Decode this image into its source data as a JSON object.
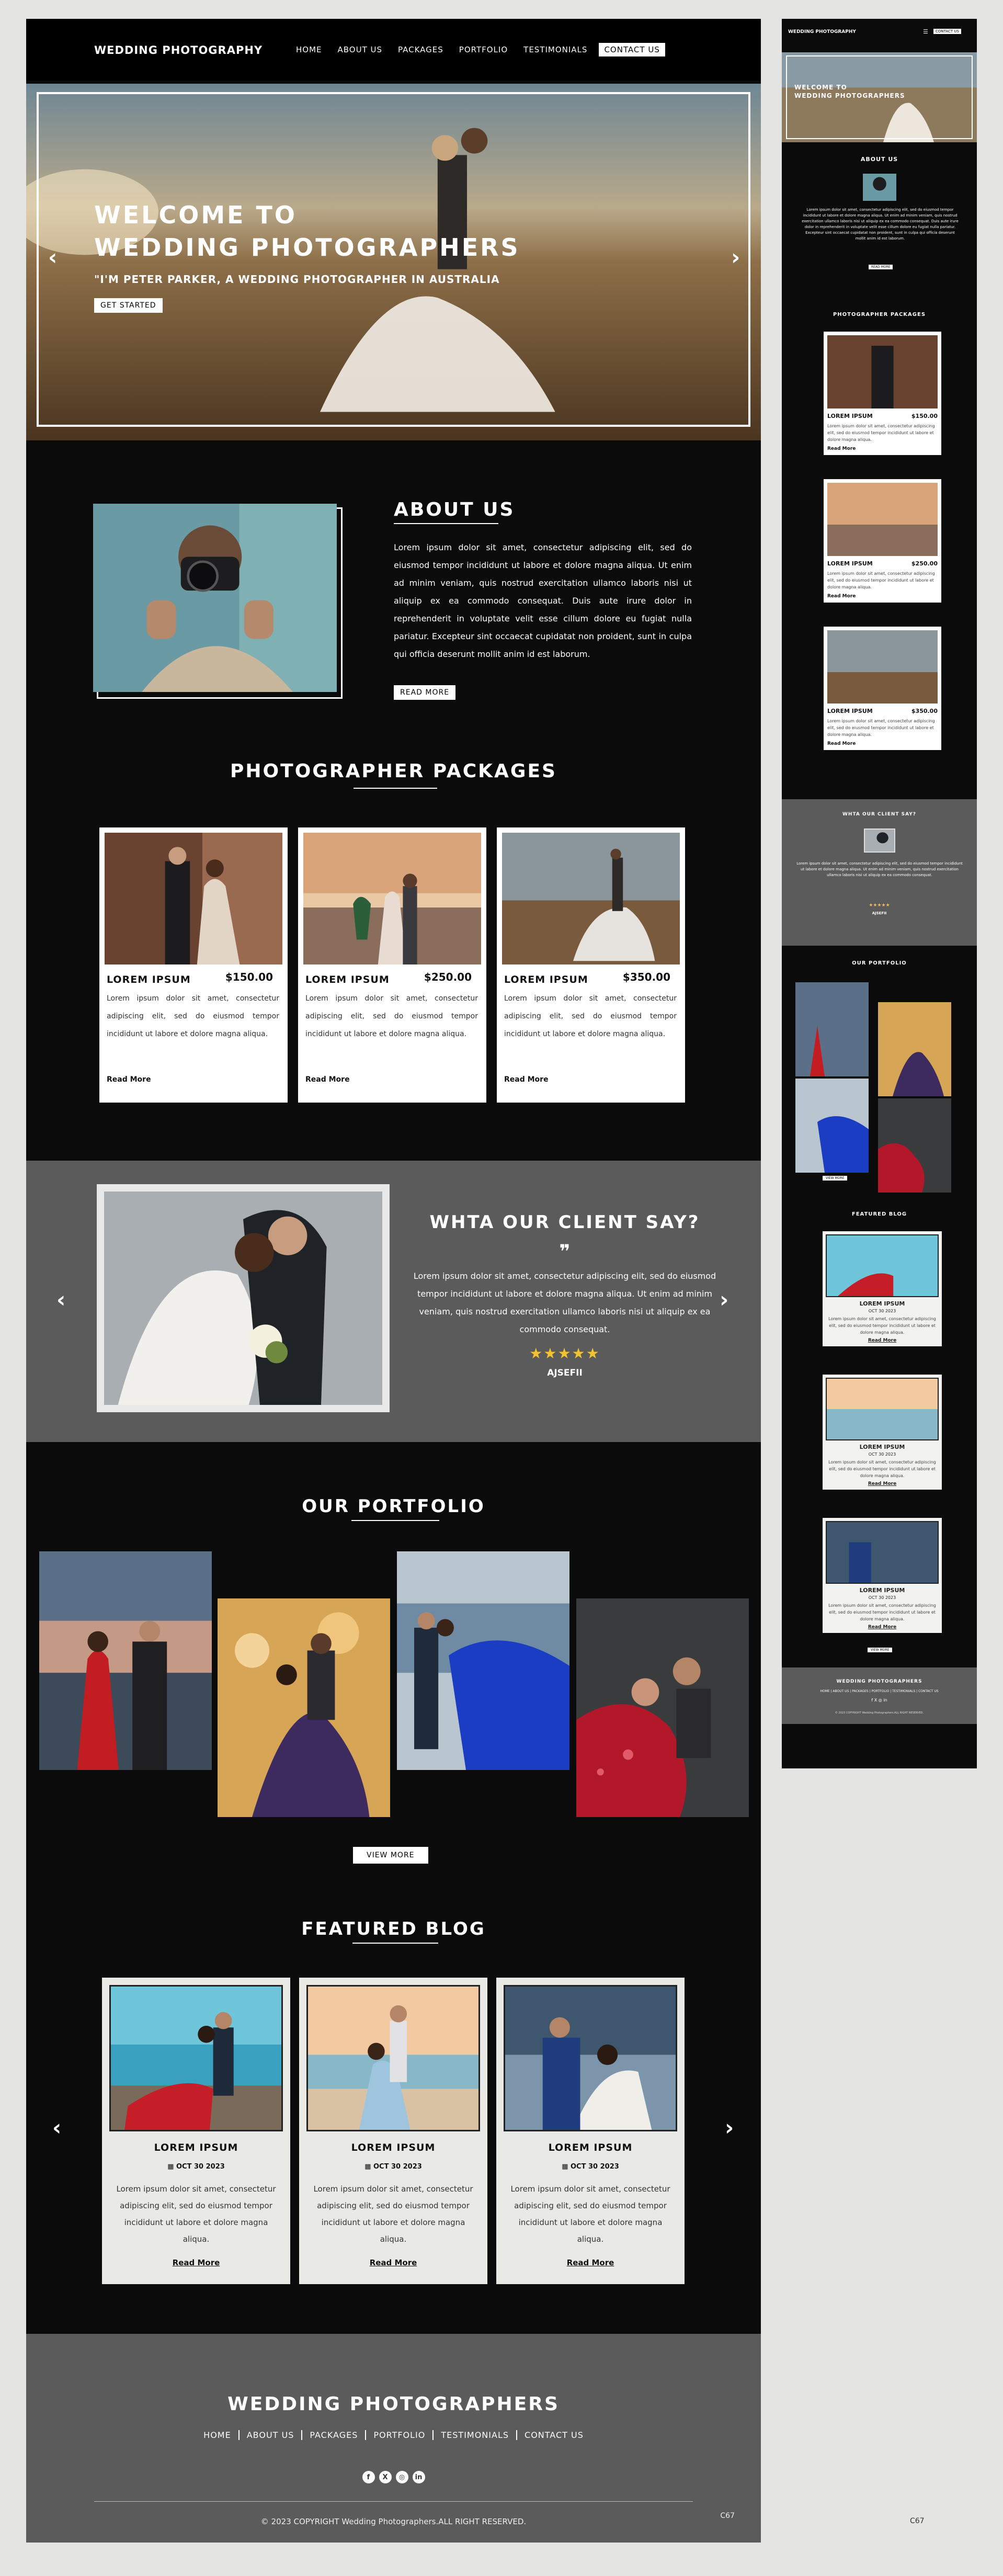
{
  "brand": "WEDDING PHOTOGRAPHY",
  "nav": [
    "HOME",
    "ABOUT US",
    "PACKAGES",
    "PORTFOLIO",
    "TESTIMONIALS",
    "CONTACT US"
  ],
  "hero": {
    "line1": "WELCOME TO",
    "line2": "WEDDING PHOTOGRAPHERS",
    "tagline": "\"I'M PETER PARKER, A WEDDING PHOTOGRAPHER IN AUSTRALIA",
    "button": "GET STARTED",
    "prev_arrow": "‹",
    "next_arrow": "›"
  },
  "about": {
    "title": "ABOUT US",
    "text": "Lorem ipsum dolor sit amet, consectetur adipiscing elit, sed do eiusmod tempor incididunt ut labore et dolore magna aliqua. Ut enim ad minim veniam, quis nostrud exercitation ullamco laboris nisi ut aliquip ex ea commodo consequat. Duis aute irure dolor in reprehenderit in voluptate velit esse cillum dolore eu fugiat nulla pariatur. Excepteur sint occaecat cupidatat non proident, sunt in culpa qui officia deserunt mollit anim id est laborum.",
    "button": "READ MORE"
  },
  "packages": {
    "title": "PHOTOGRAPHER PACKAGES",
    "items": [
      {
        "name": "LOREM IPSUM",
        "price": "$150.00",
        "desc": "Lorem ipsum dolor sit amet, consectetur adipiscing elit, sed do eiusmod tempor incididunt ut labore et dolore magna aliqua.",
        "link": "Read More"
      },
      {
        "name": "LOREM IPSUM",
        "price": "$250.00",
        "desc": "Lorem ipsum dolor sit amet, consectetur adipiscing elit, sed do eiusmod tempor incididunt ut labore et dolore magna aliqua.",
        "link": "Read More"
      },
      {
        "name": "LOREM IPSUM",
        "price": "$350.00",
        "desc": "Lorem ipsum dolor sit amet, consectetur adipiscing elit, sed do eiusmod tempor incididunt ut labore et dolore magna aliqua.",
        "link": "Read More"
      }
    ]
  },
  "testimonial": {
    "title": "WHTA OUR CLIENT SAY?",
    "quote_mark": "❞",
    "text": "Lorem ipsum dolor sit amet, consectetur adipiscing elit, sed do eiusmod tempor incididunt ut labore et dolore magna aliqua. Ut enim ad minim veniam, quis nostrud exercitation ullamco laboris nisi ut aliquip ex ea commodo consequat.",
    "stars": "★★★★★",
    "rating": 5,
    "author": "AJSEFII"
  },
  "portfolio": {
    "title": "OUR PORTFOLIO",
    "button": "VIEW MORE"
  },
  "blog": {
    "title": "FEATURED BLOG",
    "items": [
      {
        "title": "LOREM IPSUM",
        "date": "OCT 30 2023",
        "text": "Lorem ipsum dolor sit amet, consectetur adipiscing elit, sed do eiusmod tempor incididunt ut labore et dolore magna aliqua.",
        "link": "Read More"
      },
      {
        "title": "LOREM IPSUM",
        "date": "OCT 30 2023",
        "text": "Lorem ipsum dolor sit amet, consectetur adipiscing elit, sed do eiusmod tempor incididunt ut labore et dolore magna aliqua.",
        "link": "Read More"
      },
      {
        "title": "LOREM IPSUM",
        "date": "OCT 30 2023",
        "text": "Lorem ipsum dolor sit amet, consectetur adipiscing elit, sed do eiusmod tempor incididunt ut labore et dolore magna aliqua.",
        "link": "Read More"
      }
    ]
  },
  "footer": {
    "title": "WEDDING PHOTOGRAPHERS",
    "links": [
      "HOME",
      "ABOUT US",
      "PACKAGES",
      "PORTFOLIO",
      "TESTIMONIALS",
      "CONTACT US"
    ],
    "social": [
      "facebook-icon",
      "x-icon",
      "instagram-icon",
      "linkedin-icon"
    ],
    "social_glyphs": [
      "f",
      "X",
      "◎",
      "in"
    ],
    "copyright": "© 2023 COPYRIGHT   Wedding Photographers.ALL RIGHT RESERVED.",
    "code": "C67"
  },
  "mobile": {
    "brand": "WEDDING PHOTOGRAPHY",
    "contact": "CONTACT US",
    "hero_line1": "WELCOME TO",
    "hero_line2": "WEDDING PHOTOGRAPHERS",
    "about_title": "ABOUT US",
    "about_text": "Lorem ipsum dolor sit amet, consectetur adipiscing elit, sed do eiusmod tempor incididunt ut labore et dolore magna aliqua. Ut enim ad minim veniam, quis nostrud exercitation ullamco laboris nisi ut aliquip ex ea commodo consequat. Duis aute irure dolor in reprehenderit in voluptate velit esse cillum dolore eu fugiat nulla pariatur. Excepteur sint occaecat cupidatat non proident, sunt in culpa qui officia deserunt mollit anim id est laborum.",
    "about_button": "READ MORE",
    "packages_title": "PHOTOGRAPHER PACKAGES",
    "testi_title": "WHTA OUR CLIENT SAY?",
    "testi_text": "Lorem ipsum dolor sit amet, consectetur adipiscing elit, sed do eiusmod tempor incididunt ut labore et dolore magna aliqua. Ut enim ad minim veniam, quis nostrud exercitation ullamco laboris nisi ut aliquip ex ea commodo consequat.",
    "testi_author": "AJSEFII",
    "portfolio_title": "OUR PORTFOLIO",
    "portfolio_button": "VIEW MORE",
    "blog_title": "FEATURED BLOG",
    "blog_button": "VIEW MORE",
    "footer_title": "WEDDING PHOTOGRAPHERS",
    "footer_links": "HOME | ABOUT US | PACKAGES | PORTFOLIO | TESTIMONIALS | CONTACT US",
    "copyright": "© 2023 COPYRIGHT   Wedding Photographers.ALL RIGHT RESERVED.",
    "code": "C67"
  },
  "colors": {
    "page_bg": "#0b0b0b",
    "band": "#5b5b5b",
    "outer": "#e4e4e2",
    "star": "#f2c230",
    "accent_white": "#ffffff"
  }
}
